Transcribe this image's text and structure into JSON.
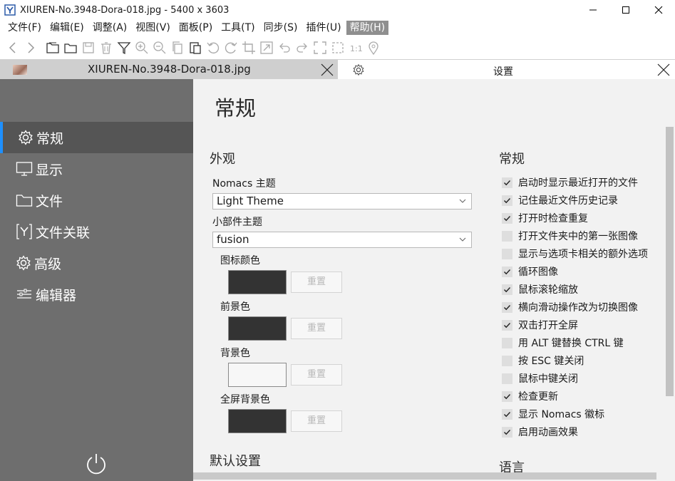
{
  "window": {
    "title": "XIUREN-No.3948-Dora-018.jpg  - 5400 x 3603"
  },
  "menu": [
    "文件(F)",
    "编辑(E)",
    "调整(A)",
    "视图(V)",
    "面板(P)",
    "工具(T)",
    "同步(S)",
    "插件(U)",
    "帮助(H)"
  ],
  "tabs": {
    "image_tab": "XIUREN-No.3948-Dora-018.jpg",
    "settings_tab": "设置"
  },
  "sidebar": {
    "items": [
      {
        "label": "常规",
        "icon": "gear-icon"
      },
      {
        "label": "显示",
        "icon": "monitor-icon"
      },
      {
        "label": "文件",
        "icon": "folder-icon"
      },
      {
        "label": "文件关联",
        "icon": "file-association-icon"
      },
      {
        "label": "高级",
        "icon": "gear-icon"
      },
      {
        "label": "编辑器",
        "icon": "sliders-icon"
      }
    ]
  },
  "content": {
    "page_title": "常规",
    "appearance": {
      "title": "外观",
      "theme_label": "Nomacs 主题",
      "theme_value": "Light Theme",
      "widget_theme_label": "小部件主题",
      "widget_theme_value": "fusion",
      "colors": [
        {
          "label": "图标颜色",
          "color": "#333333",
          "reset": "重置"
        },
        {
          "label": "前景色",
          "color": "#333333",
          "reset": "重置"
        },
        {
          "label": "背景色",
          "color": "#f7f7f7",
          "reset": "重置"
        },
        {
          "label": "全屏背景色",
          "color": "#333333",
          "reset": "重置"
        }
      ]
    },
    "defaults_title": "默认设置",
    "general": {
      "title": "常规",
      "options": [
        {
          "label": "启动时显示最近打开的文件",
          "checked": true
        },
        {
          "label": "记住最近文件历史记录",
          "checked": true
        },
        {
          "label": "打开时检查重复",
          "checked": true
        },
        {
          "label": "打开文件夹中的第一张图像",
          "checked": false
        },
        {
          "label": "显示与选项卡相关的额外选项",
          "checked": false
        },
        {
          "label": "循环图像",
          "checked": true
        },
        {
          "label": "鼠标滚轮缩放",
          "checked": true
        },
        {
          "label": "横向滑动操作改为切换图像",
          "checked": true
        },
        {
          "label": "双击打开全屏",
          "checked": true
        },
        {
          "label": "用 ALT 键替换 CTRL 键",
          "checked": false
        },
        {
          "label": "按 ESC 键关闭",
          "checked": false
        },
        {
          "label": "鼠标中键关闭",
          "checked": false
        },
        {
          "label": "检查更新",
          "checked": true
        },
        {
          "label": "显示 Nomacs 徽标",
          "checked": true
        },
        {
          "label": "启用动画效果",
          "checked": true
        }
      ]
    },
    "language_title": "语言"
  }
}
